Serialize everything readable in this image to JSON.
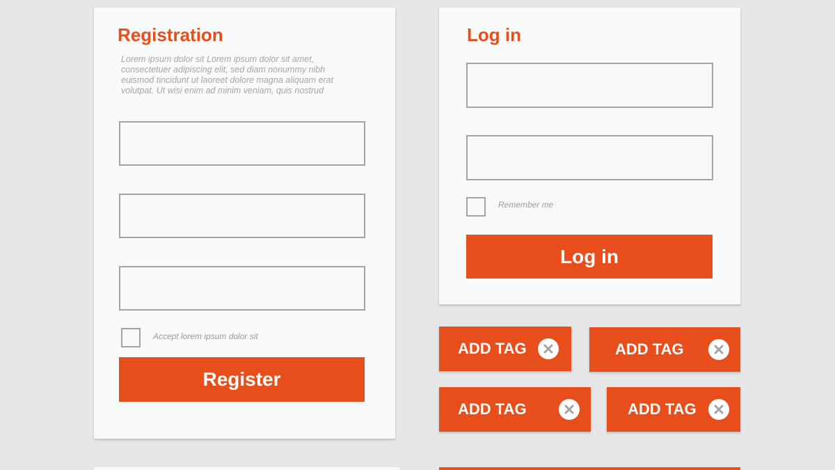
{
  "colors": {
    "accent": "#e84e1b",
    "page_background": "#e6e6e6",
    "card_background": "#f8f9f9",
    "field_border": "#a3a3a3",
    "muted_text": "#a6a6a6"
  },
  "registration": {
    "title": "Registration",
    "description": "Lorem ipsum dolor sit Lorem ipsum dolor sit amet, consectetuer adipiscing elit, sed diam nonummy nibh euismod tincidunt ut laoreet dolore magna aliquam erat volutpat. Ut wisi enim ad minim veniam, quis nostrud",
    "fields": [
      {
        "value": "",
        "placeholder": ""
      },
      {
        "value": "",
        "placeholder": ""
      },
      {
        "value": "",
        "placeholder": ""
      }
    ],
    "checkbox_label": "Accept lorem ipsum dolor sit",
    "button_label": "Register"
  },
  "login": {
    "title": "Log in",
    "fields": [
      {
        "value": "",
        "placeholder": ""
      },
      {
        "value": "",
        "placeholder": ""
      }
    ],
    "checkbox_label": "Remember me",
    "button_label": "Log in"
  },
  "tags": [
    {
      "label": "ADD TAG",
      "close_icon": "close-icon"
    },
    {
      "label": "ADD TAG",
      "close_icon": "close-icon"
    },
    {
      "label": "ADD TAG",
      "close_icon": "close-icon"
    },
    {
      "label": "ADD TAG",
      "close_icon": "close-icon"
    }
  ]
}
